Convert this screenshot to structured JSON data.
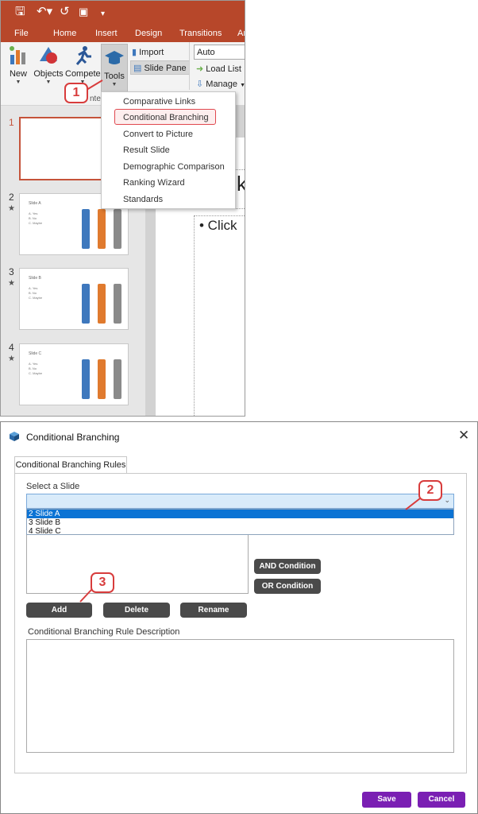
{
  "ppt": {
    "tabs": [
      "File",
      "Home",
      "Insert",
      "Design",
      "Transitions",
      "Ar"
    ],
    "ribbon": {
      "new_label": "New",
      "objects_label": "Objects",
      "compete_label": "Compete",
      "tools_label": "Tools",
      "import_label": "Import",
      "slide_pane_label": "Slide Pane",
      "auto_value": "Auto",
      "load_list_label": "Load List",
      "manage_label": "Manage",
      "group_label_partial": "nte"
    },
    "tools_menu": [
      "Comparative Links",
      "Conditional Branching",
      "Convert to Picture",
      "Result Slide",
      "Demographic Comparison",
      "Ranking Wizard",
      "Standards"
    ],
    "slides": [
      {
        "number": "1"
      },
      {
        "number": "2",
        "title": "Slide A"
      },
      {
        "number": "3",
        "title": "Slide B"
      },
      {
        "number": "4",
        "title": "Slide C"
      }
    ],
    "slide_options": [
      "A. Yes",
      "B. No",
      "C. Maybe"
    ],
    "editor_title_fragment": "k",
    "editor_body_fragment": "• Click",
    "callout_1": "1"
  },
  "dialog": {
    "title": "Conditional Branching",
    "close_glyph": "✕",
    "tab_label": "Conditional Branching Rules",
    "select_label": "Select a Slide",
    "combo_options": [
      "2 Slide A",
      "3 Slide B",
      "4 Slide C"
    ],
    "selected_option": "2 Slide A",
    "and_condition": "AND Condition",
    "or_condition": "OR Condition",
    "add": "Add",
    "delete": "Delete",
    "rename": "Rename",
    "description_label": "Conditional Branching Rule Description",
    "save": "Save",
    "cancel": "Cancel",
    "callout_2": "2",
    "callout_3": "3"
  },
  "colors": {
    "ppt_accent": "#b7472a",
    "selection_blue": "#0b73d4",
    "dialog_button": "#4a4a4a",
    "primary_button": "#7a1fb3",
    "callout_red": "#d83c3c",
    "bar_blue": "#3e78bd",
    "bar_orange": "#e07a2e",
    "bar_gray": "#8a8a8a"
  }
}
